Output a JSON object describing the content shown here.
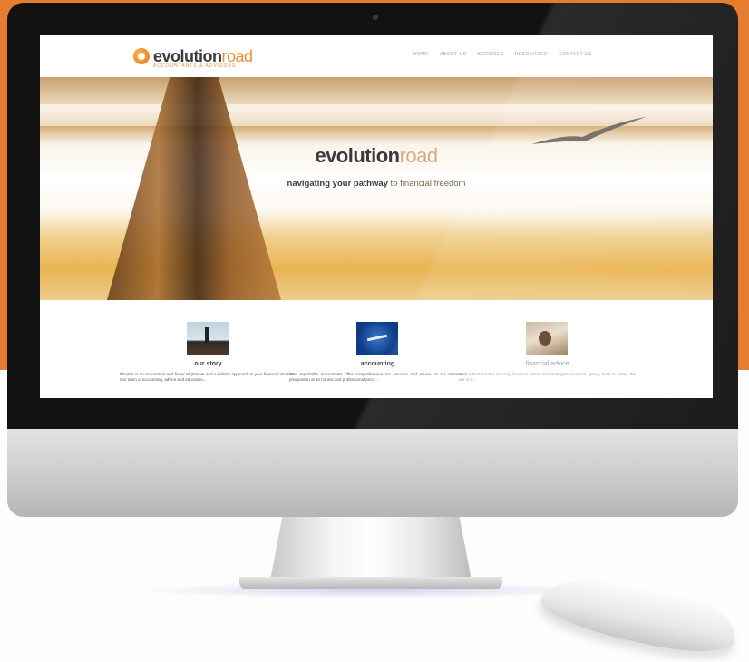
{
  "site": {
    "logo": {
      "part1": "evolution",
      "part2": "road",
      "tagline": "ACCOUNTANTS & ADVISORS"
    },
    "nav": [
      "HOME",
      "ABOUT US",
      "SERVICES",
      "RESOURCES",
      "CONTACT US"
    ],
    "hero": {
      "title_part1": "evolution",
      "title_part2": "road",
      "tagline_dark": "navigating your pathway",
      "tagline_light": " to financial freedom"
    },
    "columns": [
      {
        "title": "our story",
        "text": "Phoebe is an accountant and financial planner and a holistic approach to your financial situation. Our team of accounting, advice and education..."
      },
      {
        "title": "accounting",
        "text": "Your reportable accountants offer comprehensive tax services and advice on tax statement preparation at an honest and professional price..."
      },
      {
        "title": "financial advice",
        "text": "We understand the amazing financial needs and strategies proactive...gning, back to sleep. We are in it..."
      }
    ]
  },
  "colors": {
    "orange": "#e47d2e",
    "logo_accent": "#e7933a",
    "logo_dark": "#3b3b3b"
  }
}
